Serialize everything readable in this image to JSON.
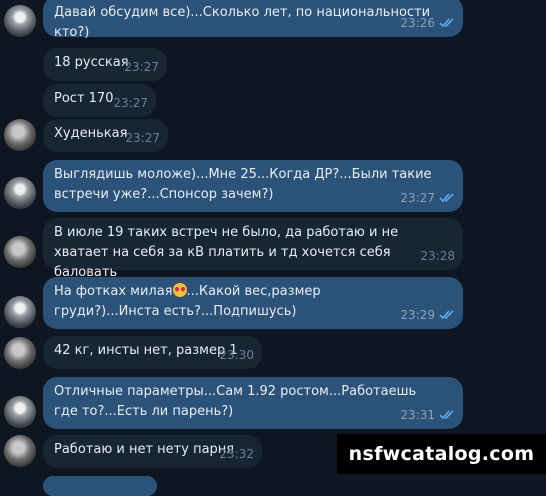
{
  "messages": [
    {
      "side": "out",
      "text": "Давай обсудим все)...Сколько лет, по национальности кто?)",
      "time": "23:26",
      "read": true
    },
    {
      "side": "in",
      "text": "18 русская",
      "time": "23:27"
    },
    {
      "side": "in",
      "text": "Рост 170",
      "time": "23:27"
    },
    {
      "side": "in",
      "text": "Худенькая",
      "time": "23:27"
    },
    {
      "side": "out",
      "text": "Выглядишь моложе)...Мне 25...Когда ДР?...Были такие встречи уже?...Спонсор зачем?)",
      "time": "23:27",
      "read": true
    },
    {
      "side": "in",
      "text": "В июле 19 таких встреч не было, да работаю и не хватает на себя за кВ платить и тд хочется себя баловать",
      "time": "23:28"
    },
    {
      "side": "out",
      "text_before": "На фотках милая",
      "emoji": "heart-eyes-emoji",
      "text_after": "...Какой вес,размер груди?)...Инста есть?...Подпишусь)",
      "time": "23:29",
      "read": true
    },
    {
      "side": "in",
      "text": "42 кг, инсты нет, размер 1",
      "time": "23:30"
    },
    {
      "side": "out",
      "text": "Отличные параметры...Сам 1.92 ростом...Работаешь где то?...Есть ли парень?)",
      "time": "23:31",
      "read": true
    },
    {
      "side": "in",
      "text": "Работаю и нет нету парня",
      "time": "23:32"
    }
  ],
  "watermark": "nsfwcatalog.com",
  "colors": {
    "background": "#0e1621",
    "incoming": "#182533",
    "outgoing": "#2b5278",
    "check": "#5eb5f7"
  }
}
